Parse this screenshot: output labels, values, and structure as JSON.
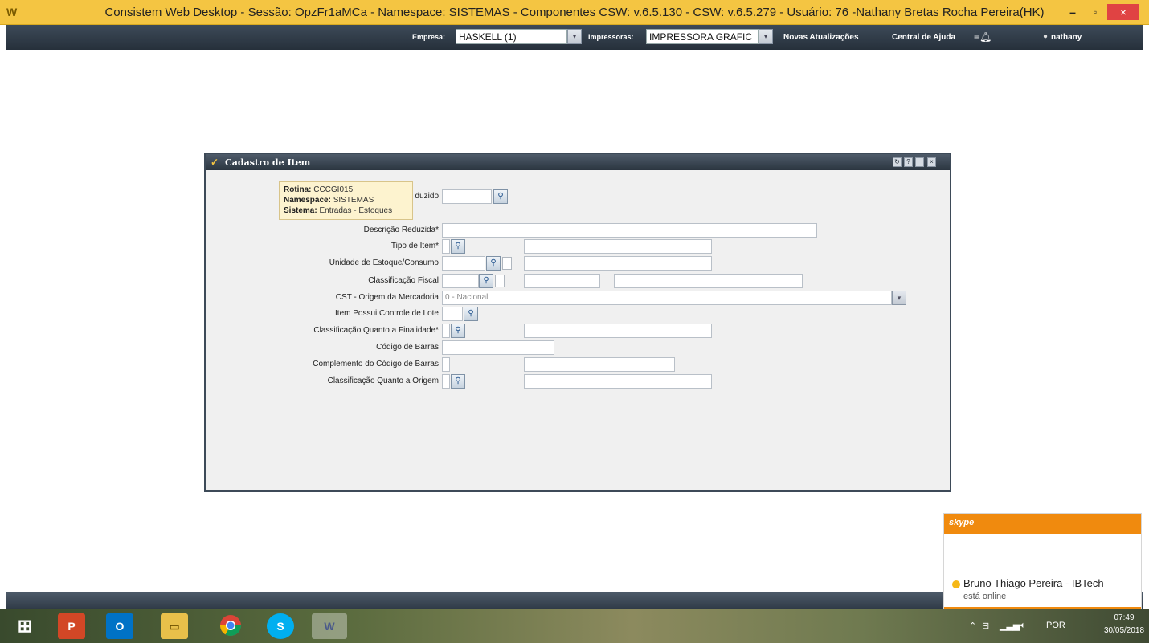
{
  "window": {
    "app_icon": "W",
    "title": "Consistem Web Desktop - Sessão: OpzFr1aMCa - Namespace: SISTEMAS - Componentes CSW: v.6.5.130 - CSW: v.6.5.279 - Usuário: 76 -Nathany Bretas Rocha Pereira(HK)",
    "minimize": "–",
    "maximize": "▫",
    "close": "×"
  },
  "appbar": {
    "empresa_label": "Empresa:",
    "empresa_value": "HASKELL (1)",
    "impressoras_label": "Impressoras:",
    "impressoras_value": "IMPRESSORA GRAFIC",
    "novas_atualizacoes": "Novas Atualizações",
    "central_ajuda": "Central de Ajuda",
    "user": "nathany"
  },
  "dialog": {
    "title": "Cadastro de Item",
    "tooltip": {
      "rotina_label": "Rotina:",
      "rotina_value": "CCCGI015",
      "namespace_label": "Namespace:",
      "namespace_value": "SISTEMAS",
      "sistema_label": "Sistema:",
      "sistema_value": "Entradas - Estoques"
    },
    "fields": {
      "codigo_reduzido": "duzido",
      "descricao_reduzida": "Descrição Reduzida*",
      "tipo_item": "Tipo de Item*",
      "unidade_estoque": "Unidade de Estoque/Consumo",
      "classificacao_fiscal": "Classificação Fiscal",
      "cst_origem": "CST - Origem da Mercadoria",
      "cst_origem_value": "0 - Nacional",
      "controle_lote": "Item Possui Controle de Lote",
      "classificacao_finalidade": "Classificação Quanto a Finalidade*",
      "codigo_barras": "Código de Barras",
      "complemento_codigo_barras": "Complemento do Código de Barras",
      "classificacao_origem": "Classificação Quanto a Origem"
    }
  },
  "skype": {
    "logo": "skype",
    "contact": "Bruno Thiago Pereira - IBTech",
    "status": "está online"
  },
  "taskbar": {
    "apps": [
      "windows-start",
      "powerpoint",
      "outlook",
      "file-explorer",
      "chrome",
      "skype",
      "consistem"
    ],
    "powerpoint_label": "P",
    "outlook_label": "O",
    "skype_label": "S",
    "language": "POR",
    "time": "07:49",
    "date": "30/05/2018"
  },
  "colors": {
    "titlebar": "#f4c542",
    "appbar": "#2f3a46",
    "skype_orange": "#f08a0e"
  }
}
